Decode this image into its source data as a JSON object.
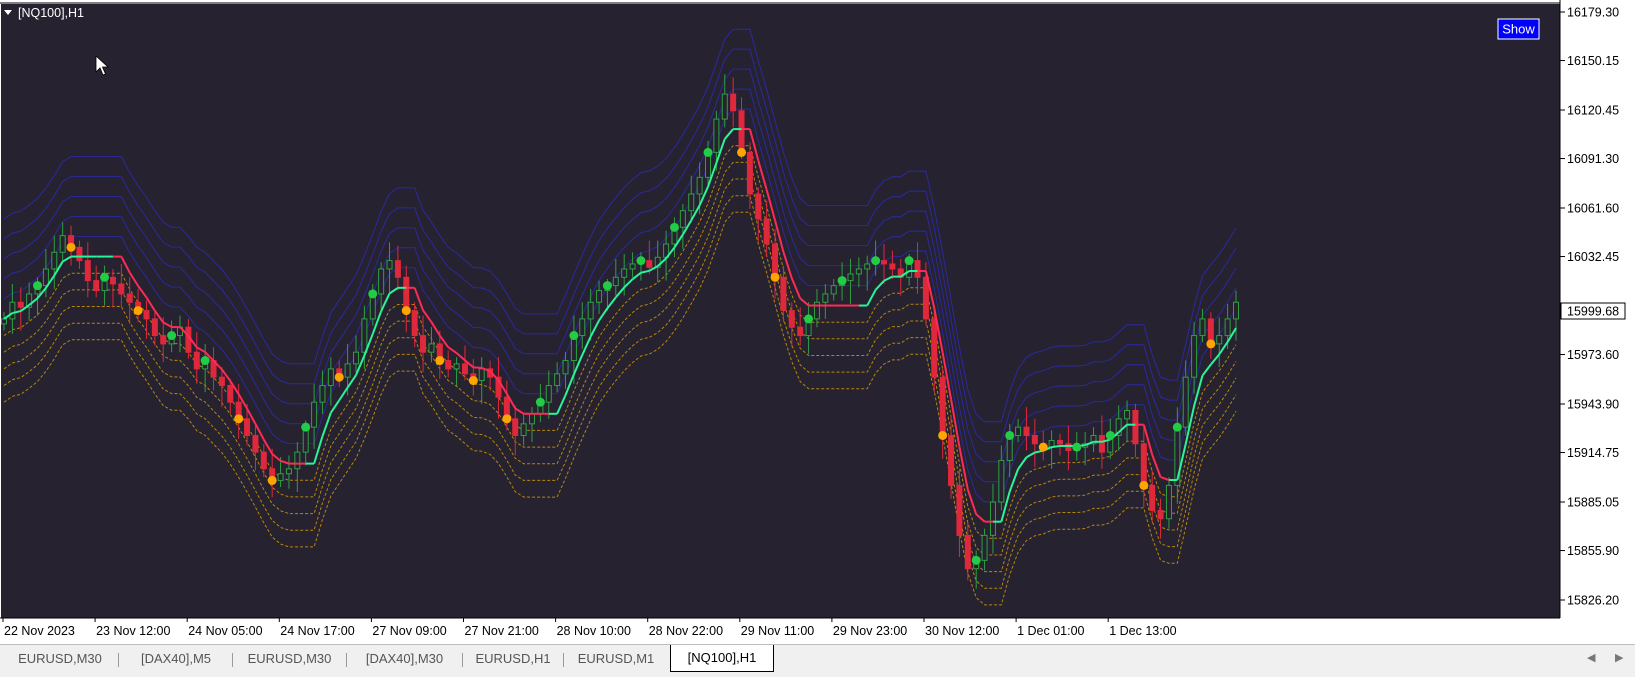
{
  "chart": {
    "symbol_title": "[NQ100],H1",
    "show_button": "Show",
    "current_price": "15999.68",
    "price_axis": [
      "16179.30",
      "16150.15",
      "16120.45",
      "16091.30",
      "16061.60",
      "16032.45",
      "15973.60",
      "15943.90",
      "15914.75",
      "15885.05",
      "15855.90",
      "15826.20"
    ],
    "time_axis": [
      "22 Nov 2023",
      "23 Nov 12:00",
      "24 Nov 05:00",
      "24 Nov 17:00",
      "27 Nov 09:00",
      "27 Nov 21:00",
      "28 Nov 10:00",
      "28 Nov 22:00",
      "29 Nov 11:00",
      "29 Nov 23:00",
      "30 Nov 12:00",
      "1 Dec 01:00",
      "1 Dec 13:00"
    ],
    "colors": {
      "background": "#262230",
      "bull": "#2ea043",
      "bear": "#e0283c",
      "line_up": "#2af598",
      "line_down": "#ff2a55",
      "band_blue": "#2a2a9e",
      "band_gold": "#b8860b",
      "dot_buy": "#22cc44",
      "dot_sell": "#ffa500",
      "show_button_bg": "#0000ff"
    }
  },
  "chart_data": {
    "type": "candlestick",
    "title": "[NQ100],H1",
    "x_range": [
      "22 Nov 2023",
      "1 Dec 13:00"
    ],
    "ylim": [
      15826.2,
      16179.3
    ],
    "grid": false,
    "last_price": 15999.68,
    "series": [
      {
        "values": [
          15995,
          16005,
          16002,
          16010,
          16015,
          16025,
          16035,
          16045,
          16038,
          16030,
          16018,
          16012,
          16020,
          16016,
          16010,
          16005,
          16000,
          15995,
          15985,
          15980,
          15985,
          15990,
          15975,
          15965,
          15970,
          15960,
          15955,
          15945,
          15935,
          15925,
          15915,
          15905,
          15898,
          15902,
          15905,
          15915,
          15930,
          15945,
          15955,
          15965,
          15960,
          15968,
          15975,
          15995,
          16010,
          16025,
          16030,
          16020,
          16000,
          15985,
          15975,
          15980,
          15970,
          15965,
          15968,
          15962,
          15958,
          15965,
          15960,
          15948,
          15935,
          15925,
          15932,
          15938,
          15945,
          15955,
          15962,
          15970,
          15985,
          15995,
          16005,
          16012,
          16015,
          16020,
          16025,
          16028,
          16030,
          16026,
          16032,
          16040,
          16050,
          16060,
          16070,
          16080,
          16095,
          16115,
          16130,
          16120,
          16095,
          16070,
          16055,
          16040,
          16020,
          16000,
          15990,
          15985,
          15995,
          16005,
          16010,
          16015,
          16018,
          16022,
          16025,
          16028,
          16030,
          16028,
          16025,
          16020,
          16030,
          16020,
          15995,
          15960,
          15925,
          15895,
          15865,
          15845,
          15850,
          15865,
          15885,
          15910,
          15925,
          15930,
          15925,
          15920,
          15918,
          15922,
          15920,
          15916,
          15918,
          15920,
          15925,
          15915,
          15925,
          15935,
          15940,
          15920,
          15895,
          15880,
          15875,
          15895,
          15930,
          15960,
          15985,
          15995,
          15980,
          15985,
          15995,
          16005
        ]
      }
    ],
    "indicators": [
      "trend line",
      "blue bands",
      "gold bands",
      "buy dots",
      "sell dots"
    ]
  },
  "tabs": [
    {
      "label": "EURUSD,M30",
      "active": false
    },
    {
      "label": "[DAX40],M5",
      "active": false
    },
    {
      "label": "EURUSD,M30",
      "active": false
    },
    {
      "label": "[DAX40],M30",
      "active": false
    },
    {
      "label": "EURUSD,H1",
      "active": false
    },
    {
      "label": "EURUSD,M1",
      "active": false
    },
    {
      "label": "[NQ100],H1",
      "active": true
    }
  ],
  "scroll": {
    "left": "◀",
    "right": "▶"
  }
}
